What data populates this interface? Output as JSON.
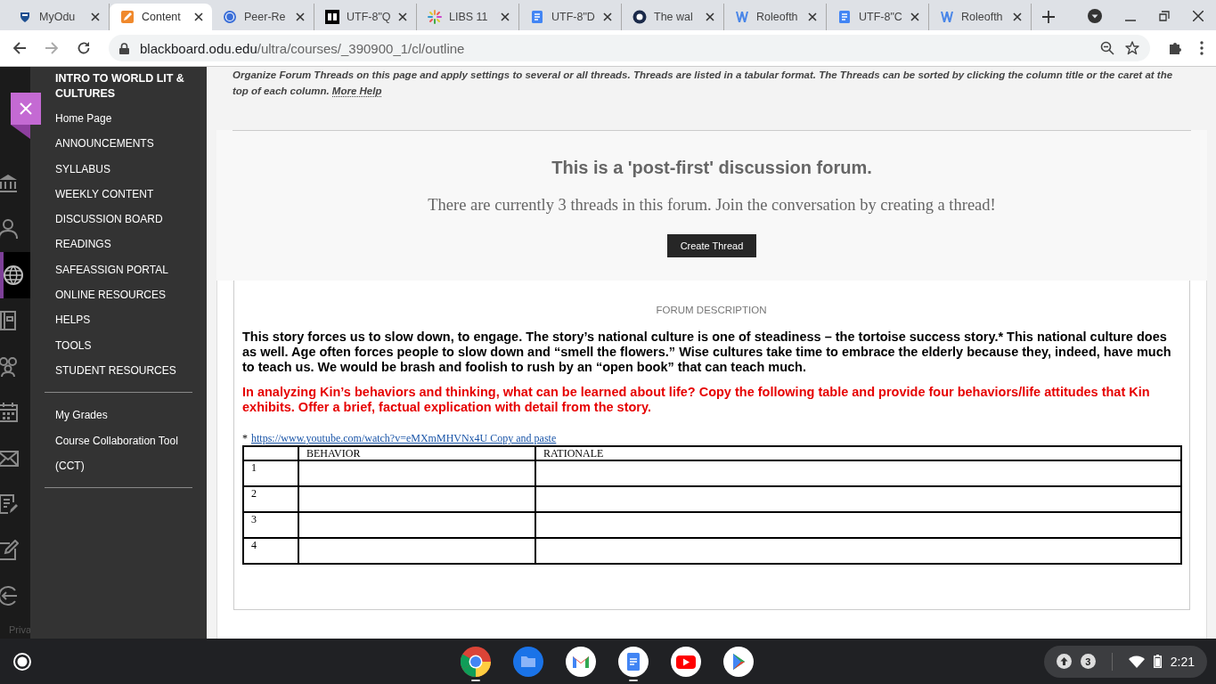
{
  "browser": {
    "tabs": [
      {
        "title": "MyOdu",
        "kind": "odu",
        "selected": false
      },
      {
        "title": "Content",
        "kind": "pencil",
        "selected": true
      },
      {
        "title": "Peer-Re",
        "kind": "circles",
        "selected": false
      },
      {
        "title": "UTF-8\"Q",
        "kind": "bb",
        "selected": false
      },
      {
        "title": "LIBS 11",
        "kind": "sparkle",
        "selected": false
      },
      {
        "title": "UTF-8\"D",
        "kind": "docs",
        "selected": false
      },
      {
        "title": "The wal",
        "kind": "ring",
        "selected": false
      },
      {
        "title": "Roleofth",
        "kind": "word",
        "selected": false
      },
      {
        "title": "UTF-8\"C",
        "kind": "docs",
        "selected": false
      },
      {
        "title": "Roleofth",
        "kind": "word",
        "selected": false
      }
    ],
    "url_host": "blackboard.odu.edu",
    "url_path": "/ultra/courses/_390900_1/cl/outline"
  },
  "rail": [
    {
      "kind": "bank",
      "selected": false
    },
    {
      "kind": "person",
      "selected": false
    },
    {
      "kind": "globe",
      "selected": true
    },
    {
      "kind": "book",
      "selected": false
    },
    {
      "kind": "people",
      "selected": false
    },
    {
      "kind": "calendar",
      "selected": false
    },
    {
      "kind": "mail",
      "selected": false
    },
    {
      "kind": "notes",
      "selected": false
    },
    {
      "kind": "edit",
      "selected": false
    },
    {
      "kind": "logout",
      "selected": false
    }
  ],
  "rail_footer": "Priva",
  "course_menu": {
    "title": "INTRO TO WORLD LIT & CULTURES",
    "groups": [
      {
        "items": [
          "Home Page",
          "ANNOUNCEMENTS",
          "SYLLABUS",
          "WEEKLY CONTENT",
          "DISCUSSION BOARD",
          "READINGS",
          "SAFEASSIGN PORTAL",
          "ONLINE RESOURCES",
          "HELPS",
          "TOOLS",
          "STUDENT RESOURCES"
        ]
      },
      {
        "items": [
          "My Grades",
          "Course Collaboration Tool (CCT)"
        ]
      }
    ]
  },
  "forum": {
    "instructions": "Organize Forum Threads on this page and apply settings to several or all threads. Threads are listed in a tabular format. The Threads can be sorted by clicking the column title or the caret at the top of each column.",
    "help_link": "More Help",
    "notice_title": "This is a 'post-first' discussion forum.",
    "notice_text": "There are currently 3 threads in this forum. Join the conversation by creating a thread!",
    "create_button": "Create Thread",
    "description_label": "FORUM DESCRIPTION",
    "paragraphs": [
      {
        "kind": "statement",
        "text": "This story forces us to slow down, to engage. The story’s national culture is one of steadiness – the tortoise success story.* This national culture does as well. Age often forces people to slow down and “smell the flowers.” Wise cultures take time to embrace the elderly because they, indeed, have much to teach us. We would be brash and foolish to rush by an “open book” that can teach much."
      },
      {
        "kind": "question",
        "text": "In analyzing Kin’s behaviors and thinking, what can be learned about life?  Copy the following table and provide four behaviors/life attitudes that Kin exhibits. Offer a brief, factual explication with detail from the story."
      }
    ],
    "footnote_mark": "*",
    "footnote_link": "https://www.youtube.com/watch?v=eMXmMHVNx4U Copy and paste",
    "table": {
      "columns": [
        "BEHAVIOR",
        "RATIONALE"
      ],
      "rows": [
        "1",
        "2",
        "3",
        "4"
      ]
    }
  },
  "shelf": {
    "apps": [
      {
        "kind": "chrome",
        "running": true
      },
      {
        "kind": "files",
        "running": false
      },
      {
        "kind": "gmail",
        "running": false
      },
      {
        "kind": "docs",
        "running": true
      },
      {
        "kind": "youtube",
        "running": false
      },
      {
        "kind": "play",
        "running": false
      }
    ],
    "notification_count": "3",
    "time": "2:21"
  }
}
